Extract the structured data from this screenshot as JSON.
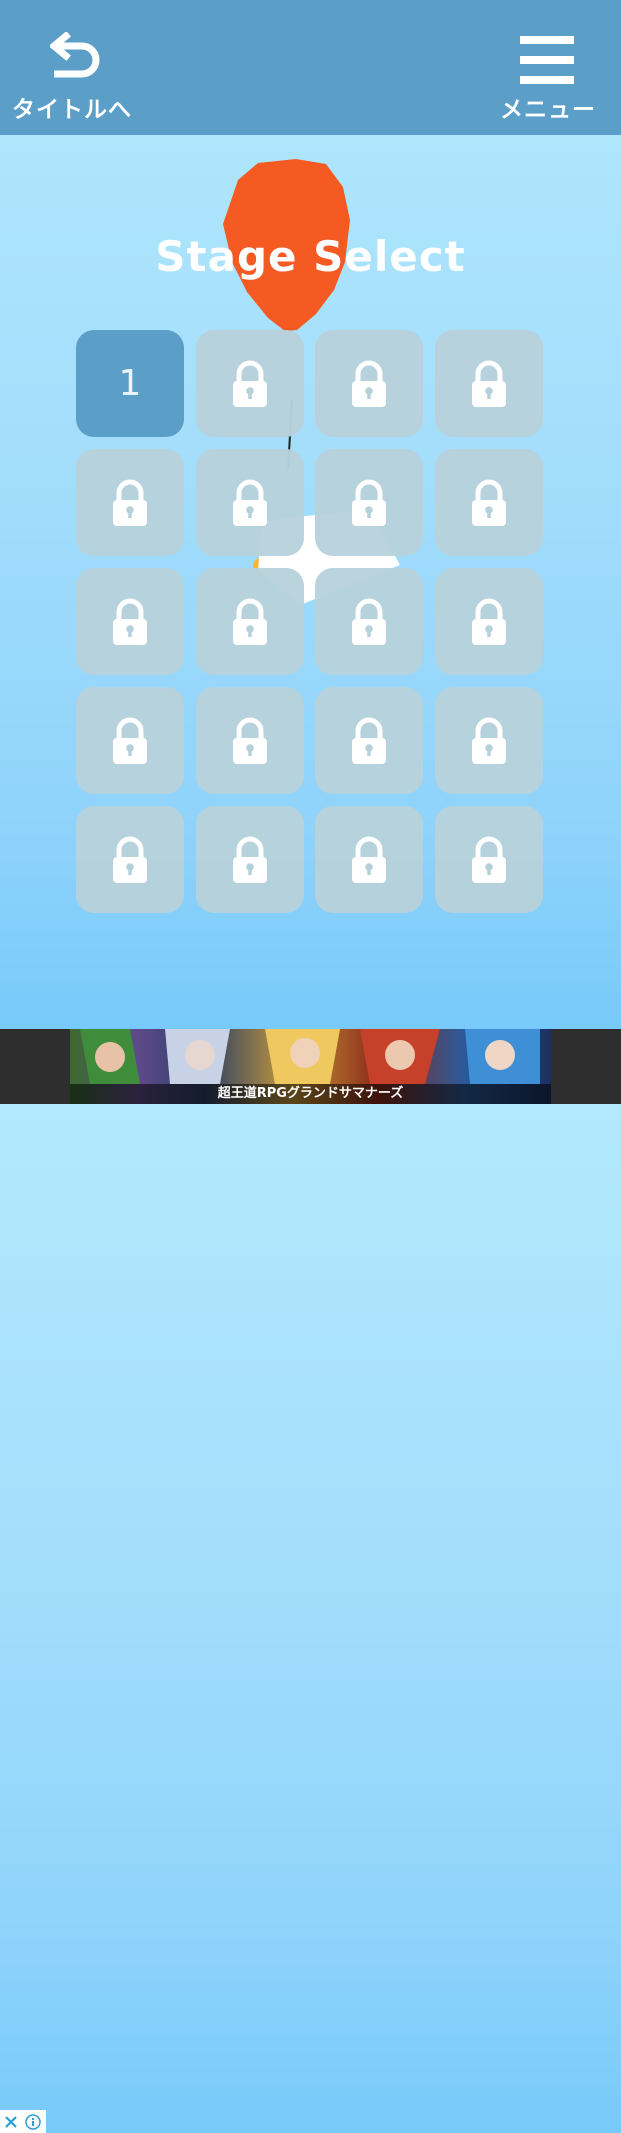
{
  "header": {
    "back_label": "タイトルへ",
    "menu_label": "メニュー",
    "bg_color": "#5b9ec8"
  },
  "title": "Stage Select",
  "stages": [
    {
      "label": "1",
      "locked": false
    },
    {
      "label": "",
      "locked": true
    },
    {
      "label": "",
      "locked": true
    },
    {
      "label": "",
      "locked": true
    },
    {
      "label": "",
      "locked": true
    },
    {
      "label": "",
      "locked": true
    },
    {
      "label": "",
      "locked": true
    },
    {
      "label": "",
      "locked": true
    },
    {
      "label": "",
      "locked": true
    },
    {
      "label": "",
      "locked": true
    },
    {
      "label": "",
      "locked": true
    },
    {
      "label": "",
      "locked": true
    },
    {
      "label": "",
      "locked": true
    },
    {
      "label": "",
      "locked": true
    },
    {
      "label": "",
      "locked": true
    },
    {
      "label": "",
      "locked": true
    },
    {
      "label": "",
      "locked": true
    },
    {
      "label": "",
      "locked": true
    },
    {
      "label": "",
      "locked": true
    },
    {
      "label": "",
      "locked": true
    }
  ],
  "icons": {
    "back": "undo-arrow-icon",
    "menu": "hamburger-icon",
    "lock": "lock-icon",
    "ad_close": "close-icon",
    "ad_info": "info-icon"
  },
  "colors": {
    "unlocked_tile": "#5b9ec8",
    "locked_tile": "#b7d1db",
    "balloon": "#f45a22"
  },
  "ad": {
    "text": "超王道RPGグランドサマナーズ"
  }
}
